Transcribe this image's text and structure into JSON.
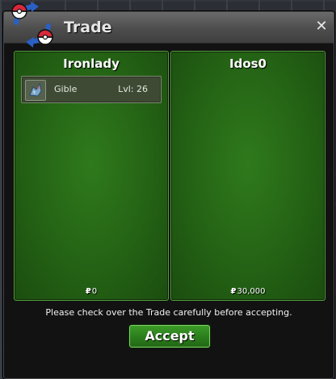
{
  "window": {
    "title": "Trade",
    "close_icon": "close-icon",
    "title_icon": "trade-arrows-icon"
  },
  "left_panel": {
    "player_name": "Ironlady",
    "items": [
      {
        "icon": "pokemon-sprite-icon",
        "name": "Gible",
        "level": "Lvl: 26"
      }
    ],
    "currency_symbol": "₽",
    "money": "0"
  },
  "right_panel": {
    "player_name": "Idos0",
    "items": [],
    "currency_symbol": "₽",
    "money": "30,000"
  },
  "notice": "Please check over the Trade carefully before accepting.",
  "accept_label": "Accept",
  "colors": {
    "panel_green": "#236014",
    "panel_border": "#56a03c",
    "button_green": "#2b7d1c",
    "window_bg": "#121212",
    "pokeball_red": "#d8283a",
    "arrow_blue": "#2a5fc4"
  }
}
